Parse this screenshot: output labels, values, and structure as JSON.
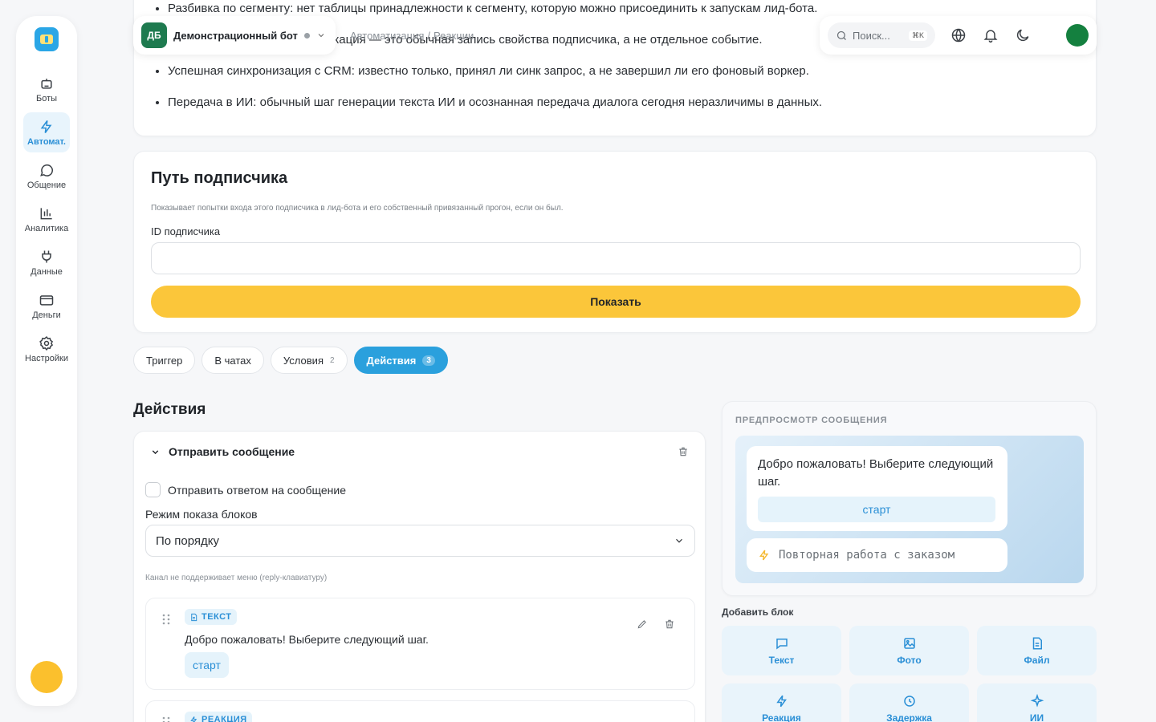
{
  "sidebar": {
    "items": [
      {
        "label": "Боты",
        "icon": "bot-icon"
      },
      {
        "label": "Автомат.",
        "icon": "lightning-icon",
        "active": true
      },
      {
        "label": "Общение",
        "icon": "chat-bubble-icon"
      },
      {
        "label": "Аналитика",
        "icon": "bar-chart-icon"
      },
      {
        "label": "Данные",
        "icon": "plug-icon"
      },
      {
        "label": "Деньги",
        "icon": "card-icon"
      },
      {
        "label": "Настройки",
        "icon": "gear-icon"
      }
    ]
  },
  "header": {
    "bot_initials": "ДБ",
    "bot_name": "Демонстрационный бот",
    "breadcrumb": [
      "Автоматизация",
      "Реакции"
    ],
    "search_placeholder": "Поиск...",
    "search_shortcut": "⌘K"
  },
  "notes": {
    "items": [
      "Разбивка по сегменту: нет таблицы принадлежности к сегменту, которую можно присоединить к запускам лид-бота.",
      "«Квалифицирован»: квалификация — это обычная запись свойства подписчика, а не отдельное событие.",
      "Успешная синхронизация с CRM: известно только, принял ли синк запрос, а не завершил ли его фоновый воркер.",
      "Передача в ИИ: обычный шаг генерации текста ИИ и осознанная передача диалога сегодня неразличимы в данных."
    ]
  },
  "subscriber_path": {
    "title": "Путь подписчика",
    "description": "Показывает попытки входа этого подписчика в лид-бота и его собственный привязанный прогон, если он был.",
    "field_label": "ID подписчика",
    "field_value": "",
    "button_label": "Показать"
  },
  "tabs": [
    {
      "label": "Триггер",
      "count": ""
    },
    {
      "label": "В чатах",
      "count": ""
    },
    {
      "label": "Условия",
      "count": "2"
    },
    {
      "label": "Действия",
      "count": "3",
      "active": true
    }
  ],
  "actions": {
    "title": "Действия",
    "card_title": "Отправить сообщение",
    "reply_checkbox_label": "Отправить ответом на сообщение",
    "mode_label": "Режим показа блоков",
    "mode_value": "По порядку",
    "hint": "Канал не поддерживает меню (reply-клавиатуру)",
    "blocks": [
      {
        "type": "ТЕКСТ",
        "text": "Добро пожаловать! Выберите следующий шаг.",
        "button": "старт"
      },
      {
        "type": "РЕАКЦИЯ"
      }
    ]
  },
  "preview": {
    "label": "ПРЕДПРОСМОТР СООБЩЕНИЯ",
    "message": "Добро пожаловать! Выберите следующий шаг.",
    "inline_button": "старт",
    "keyboard_button": "Повторная работа с заказом"
  },
  "add_block": {
    "label": "Добавить блок",
    "items": [
      {
        "label": "Текст",
        "icon": "message-icon"
      },
      {
        "label": "Фото",
        "icon": "image-icon"
      },
      {
        "label": "Файл",
        "icon": "file-icon"
      },
      {
        "label": "Реакция",
        "icon": "lightning-icon"
      },
      {
        "label": "Задержка",
        "icon": "clock-icon"
      },
      {
        "label": "ИИ",
        "icon": "sparkle-icon"
      }
    ]
  },
  "colors": {
    "accent": "#2aa0dd",
    "primary_button": "#fbc63a",
    "bot_avatar": "#1e7a4f",
    "user_avatar": "#14803f"
  }
}
